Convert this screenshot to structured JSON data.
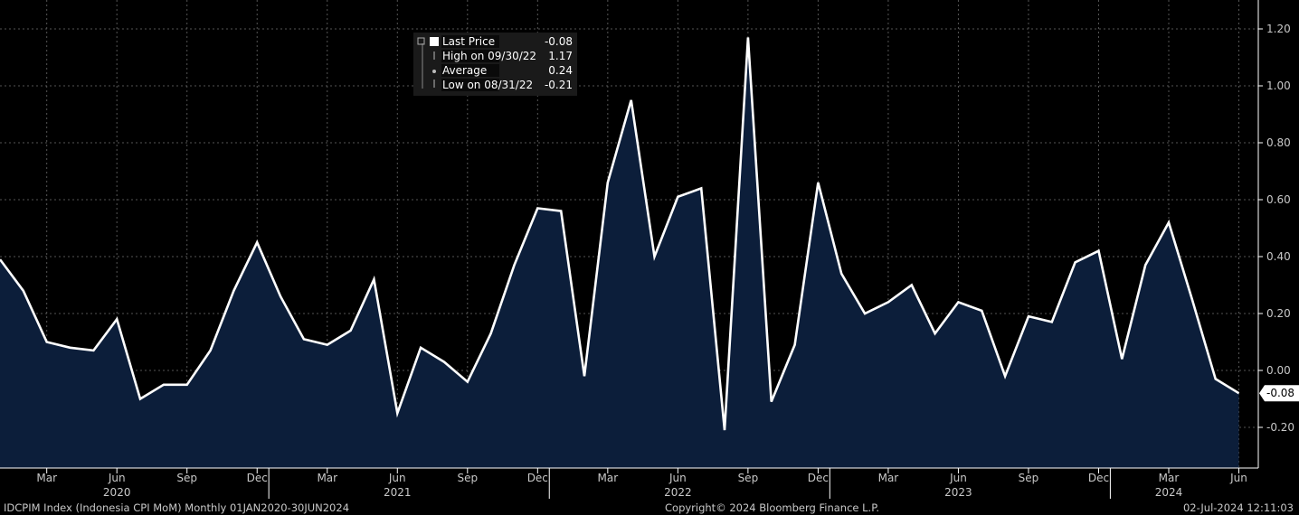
{
  "chart_data": {
    "type": "area",
    "series": [
      {
        "name": "IDCPIM Index",
        "start": "2020-01",
        "values": [
          0.39,
          0.28,
          0.1,
          0.08,
          0.07,
          0.18,
          -0.1,
          -0.05,
          -0.05,
          0.07,
          0.28,
          0.45,
          0.26,
          0.11,
          0.09,
          0.14,
          0.32,
          -0.15,
          0.08,
          0.03,
          -0.04,
          0.13,
          0.37,
          0.57,
          0.56,
          -0.02,
          0.66,
          0.95,
          0.4,
          0.61,
          0.64,
          -0.21,
          1.17,
          -0.11,
          0.09,
          0.66,
          0.34,
          0.2,
          0.24,
          0.3,
          0.13,
          0.24,
          0.21,
          -0.02,
          0.19,
          0.17,
          0.38,
          0.42,
          0.04,
          0.37,
          0.52,
          0.25,
          -0.03,
          -0.08
        ]
      }
    ],
    "ylim": [
      -0.35,
      1.3
    ],
    "yticks": [
      1.2,
      1.0,
      0.8,
      0.6,
      0.4,
      0.2,
      0.0,
      -0.2
    ],
    "ytick_labels": [
      "1.20",
      "1.00",
      "0.80",
      "0.60",
      "0.40",
      "0.20",
      "0.00",
      "-0.20"
    ],
    "month_ticks": [
      {
        "i": 2,
        "label": "Mar"
      },
      {
        "i": 5,
        "label": "Jun"
      },
      {
        "i": 8,
        "label": "Sep"
      },
      {
        "i": 11,
        "label": "Dec"
      },
      {
        "i": 14,
        "label": "Mar"
      },
      {
        "i": 17,
        "label": "Jun"
      },
      {
        "i": 20,
        "label": "Sep"
      },
      {
        "i": 23,
        "label": "Dec"
      },
      {
        "i": 26,
        "label": "Mar"
      },
      {
        "i": 29,
        "label": "Jun"
      },
      {
        "i": 32,
        "label": "Sep"
      },
      {
        "i": 35,
        "label": "Dec"
      },
      {
        "i": 38,
        "label": "Mar"
      },
      {
        "i": 41,
        "label": "Jun"
      },
      {
        "i": 44,
        "label": "Sep"
      },
      {
        "i": 47,
        "label": "Dec"
      },
      {
        "i": 50,
        "label": "Mar"
      },
      {
        "i": 53,
        "label": "Jun"
      }
    ],
    "year_labels": [
      {
        "i": 5,
        "label": "2020"
      },
      {
        "i": 17,
        "label": "2021"
      },
      {
        "i": 29,
        "label": "2022"
      },
      {
        "i": 41,
        "label": "2023"
      },
      {
        "i": 50,
        "label": "2024"
      }
    ],
    "last_value_label": "-0.08",
    "grid": true,
    "legend": {
      "placement": "top-left",
      "rows": [
        {
          "label": "Last Price",
          "value": "-0.08"
        },
        {
          "label": "High on 09/30/22",
          "value": "1.17"
        },
        {
          "label": "Average",
          "value": "0.24"
        },
        {
          "label": "Low on 08/31/22",
          "value": "-0.21"
        }
      ]
    },
    "colors": {
      "background": "#000000",
      "area": "#0c1e3a",
      "line": "#ffffff",
      "grid": "#555555"
    }
  },
  "footer": {
    "left": "IDCPIM Index (Indonesia CPI MoM)  Monthly 01JAN2020-30JUN2024",
    "center": "Copyright© 2024 Bloomberg Finance L.P.",
    "right": "02-Jul-2024 12:11:03"
  }
}
